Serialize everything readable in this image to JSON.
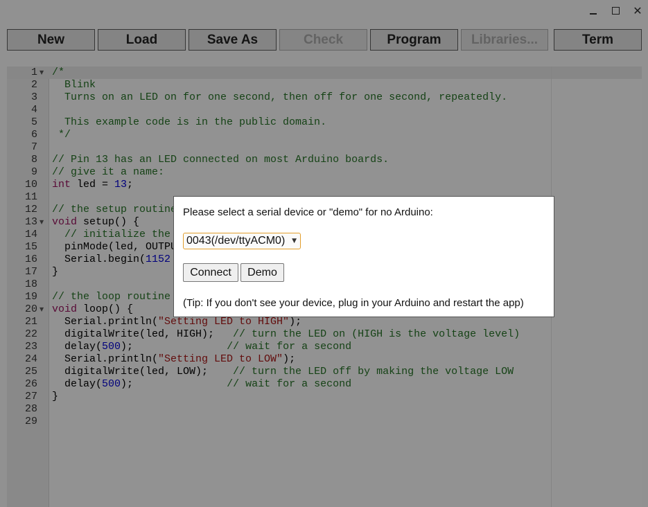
{
  "window": {
    "controls": {
      "minimize_icon": "minimize-icon",
      "maximize_icon": "maximize-icon",
      "close_icon": "close-icon",
      "close_glyph": "✕"
    }
  },
  "toolbar": {
    "new_label": "New",
    "load_label": "Load",
    "save_as_label": "Save As",
    "check_label": "Check",
    "program_label": "Program",
    "libraries_label": "Libraries...",
    "term_label": "Term"
  },
  "editor": {
    "line_numbers": [
      "1",
      "2",
      "3",
      "4",
      "5",
      "6",
      "7",
      "8",
      "9",
      "10",
      "11",
      "12",
      "13",
      "14",
      "15",
      "16",
      "17",
      "18",
      "19",
      "20",
      "21",
      "22",
      "23",
      "24",
      "25",
      "26",
      "27",
      "28",
      "29"
    ],
    "lines": {
      "l1": "/*",
      "l2": "  Blink",
      "l3": "  Turns on an LED on for one second, then off for one second, repeatedly.",
      "l5": "  This example code is in the public domain.",
      "l6": " */",
      "l8": "// Pin 13 has an LED connected on most Arduino boards.",
      "l9": "// give it a name:",
      "l10_kw": "int",
      "l10_mid": " led = ",
      "l10_num": "13",
      "l10_end": ";",
      "l12": "// the setup routine",
      "l13_kw": "void",
      "l13_rest": " setup() {",
      "l14": "  // initialize the",
      "l15": "  pinMode(led, OUTPU",
      "l16_a": "  Serial.begin(",
      "l16_num": "1152",
      "l17": "}",
      "l19": "// the loop routine",
      "l20_kw": "void",
      "l20_rest": " loop() {",
      "l21_a": "  Serial.println(",
      "l21_str": "\"Setting LED to HIGH\"",
      "l21_b": ");",
      "l22_a": "  digitalWrite(led, HIGH);   ",
      "l22_c": "// turn the LED on (HIGH is the voltage level)",
      "l23_a": "  delay(",
      "l23_num": "500",
      "l23_b": ");               ",
      "l23_c": "// wait for a second",
      "l24_a": "  Serial.println(",
      "l24_str": "\"Setting LED to LOW\"",
      "l24_b": ");",
      "l25_a": "  digitalWrite(led, LOW);    ",
      "l25_c": "// turn the LED off by making the voltage LOW",
      "l26_a": "  delay(",
      "l26_num": "500",
      "l26_b": ");               ",
      "l26_c": "// wait for a second",
      "l27": "}"
    }
  },
  "dialog": {
    "prompt": "Please select a serial device or \"demo\" for no Arduino:",
    "device_selected": "0043(/dev/ttyACM0)",
    "connect_label": "Connect",
    "demo_label": "Demo",
    "tip": "(Tip: If you don't see your device, plug in your Arduino and restart the app)"
  }
}
